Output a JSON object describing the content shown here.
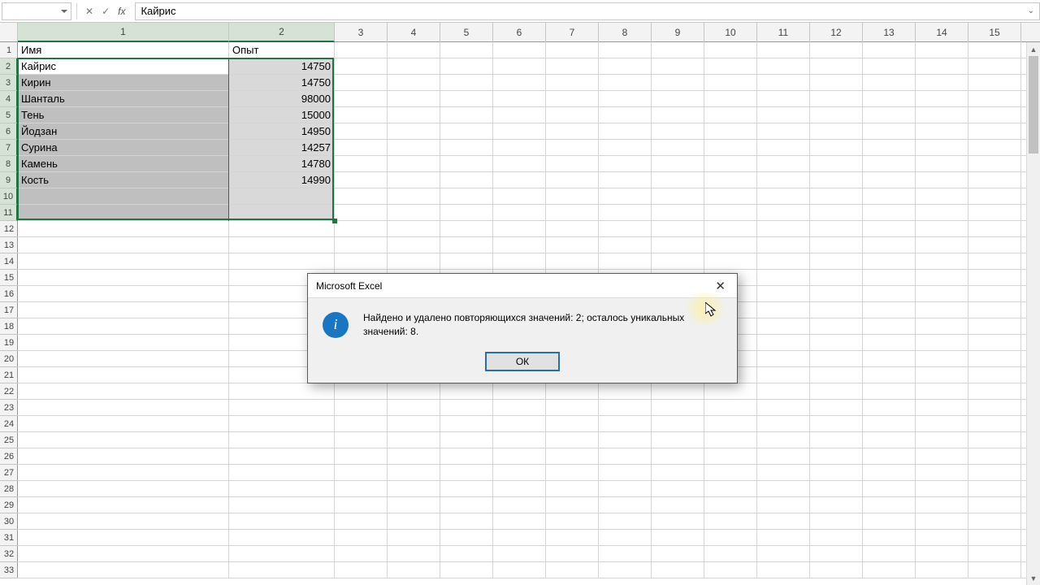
{
  "formula_bar": {
    "name_box": "",
    "fx": "fx",
    "value": "Кайрис",
    "cancel_glyph": "✕",
    "confirm_glyph": "✓"
  },
  "columns": {
    "wide": [
      1,
      2
    ],
    "count": 16,
    "wide_width": 260,
    "narrow_width": 130,
    "narrow_width_regular": 65
  },
  "sheet": {
    "headers": {
      "c1": "Имя",
      "c2": "Опыт"
    },
    "rows": [
      {
        "c1": "Кайрис",
        "c2": "14750"
      },
      {
        "c1": "Кирин",
        "c2": "14750"
      },
      {
        "c1": "Шанталь",
        "c2": "98000"
      },
      {
        "c1": "Тень",
        "c2": "15000"
      },
      {
        "c1": "Йодзан",
        "c2": "14950"
      },
      {
        "c1": "Сурина",
        "c2": "14257"
      },
      {
        "c1": "Камень",
        "c2": "14780"
      },
      {
        "c1": "Кость",
        "c2": "14990"
      }
    ]
  },
  "selection": {
    "from_row": 2,
    "to_row": 11,
    "from_col": 1,
    "to_col": 2
  },
  "row_count": 33,
  "dialog": {
    "title": "Microsoft Excel",
    "message": "Найдено и удалено повторяющихся значений: 2; осталось уникальных значений: 8.",
    "ok_label": "ОК"
  }
}
